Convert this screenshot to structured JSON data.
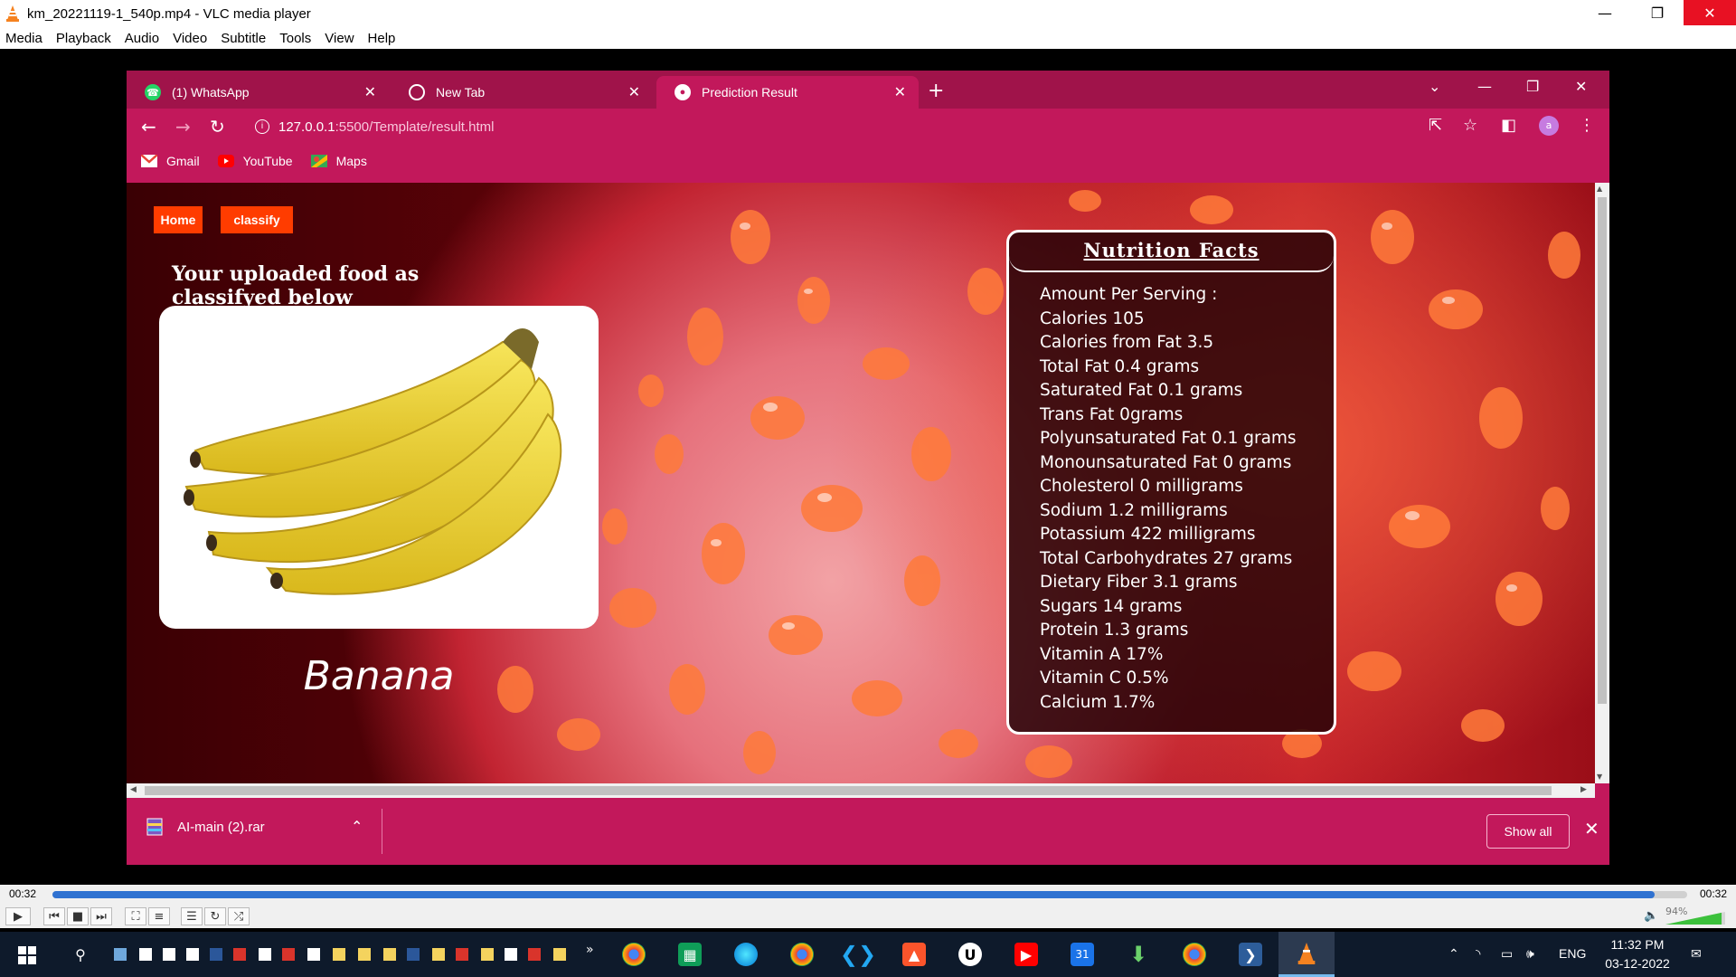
{
  "vlc": {
    "window_title": "km_20221119-1_540p.mp4 - VLC media player",
    "menu": [
      "Media",
      "Playback",
      "Audio",
      "Video",
      "Subtitle",
      "Tools",
      "View",
      "Help"
    ],
    "time_elapsed": "00:32",
    "time_total": "00:32",
    "progress": 0.98,
    "volume_label": "94%",
    "volume": 0.94
  },
  "browser": {
    "tabs": [
      {
        "label": "(1) WhatsApp",
        "icon": "whatsapp-icon"
      },
      {
        "label": "New Tab",
        "icon": "chrome-icon"
      },
      {
        "label": "Prediction Result",
        "icon": "globe-icon"
      }
    ],
    "url_host": "127.0.0.1",
    "url_path": ":5500/Template/result.html",
    "avatar_letter": "a",
    "bookmarks": [
      {
        "label": "Gmail",
        "icon": "gmail-icon"
      },
      {
        "label": "YouTube",
        "icon": "youtube-icon"
      },
      {
        "label": "Maps",
        "icon": "maps-icon"
      }
    ],
    "download_file": "AI-main (2).rar",
    "show_all": "Show all"
  },
  "page": {
    "nav": {
      "home": "Home",
      "classify": "classify"
    },
    "heading": "Your uploaded food as classifyed below",
    "food_name": "Banana",
    "nutrition_title": "Nutrition Facts",
    "nutrition": [
      "Amount Per Serving :",
      "Calories 105",
      "Calories from Fat 3.5",
      "Total Fat 0.4 grams",
      "Saturated Fat 0.1 grams",
      "Trans Fat 0grams",
      "Polyunsaturated Fat 0.1 grams",
      "Monounsaturated Fat 0 grams",
      "Cholesterol 0 milligrams",
      "Sodium 1.2 milligrams",
      "Potassium 422 milligrams",
      "Total Carbohydrates 27 grams",
      "Dietary Fiber 3.1 grams",
      "Sugars 14 grams",
      "Protein 1.3 grams",
      "Vitamin A 17%",
      "Vitamin C 0.5%",
      "Calcium 1.7%"
    ]
  },
  "taskbar": {
    "lang": "ENG",
    "time": "11:32 PM",
    "date": "03-12-2022"
  },
  "colors": {
    "browser_accent": "#c2185b",
    "nav_button": "#ff3c00",
    "vlc_progress": "#3072d1",
    "taskbar": "#0e1a2b"
  }
}
